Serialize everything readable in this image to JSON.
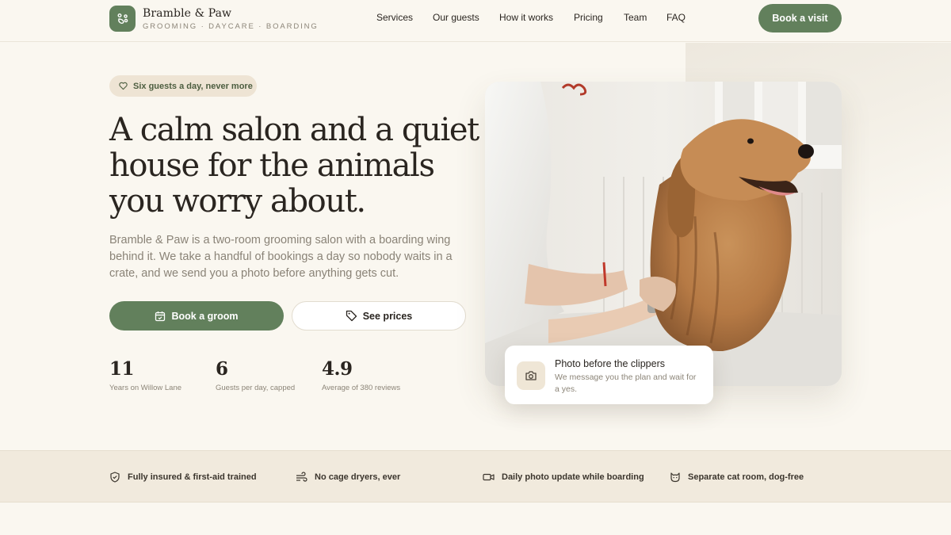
{
  "brand": {
    "name": "Bramble & Paw",
    "tagline": "GROOMING · DAYCARE · BOARDING",
    "accent": "#62805c"
  },
  "nav": {
    "items": [
      "Services",
      "Our guests",
      "How it works",
      "Pricing",
      "Team",
      "FAQ"
    ],
    "cta": "Book a visit"
  },
  "hero": {
    "pill": "Six guests a day, never more",
    "heading_line1": "A calm salon and a quiet",
    "heading_line2": "house for the animals",
    "heading_line3": "you worry about.",
    "lead": "Bramble & Paw is a two-room grooming salon with a boarding wing behind it. We take a handful of bookings a day so nobody waits in a crate, and we send you a photo before anything gets cut.",
    "primary_button": "Book a groom",
    "secondary_button": "See prices"
  },
  "stats": [
    {
      "value": "11",
      "label": "Years on Willow Lane"
    },
    {
      "value": "6",
      "label": "Guests per day, capped"
    },
    {
      "value": "4.9",
      "label": "Average of 380 reviews"
    }
  ],
  "photo_card": {
    "title": "Photo before the clippers",
    "text": "We message you the plan and wait for a yes.",
    "icon": "camera-icon"
  },
  "features": [
    {
      "icon": "shield-check-icon",
      "label": "Fully insured & first-aid trained"
    },
    {
      "icon": "wind-icon",
      "label": "No cage dryers, ever"
    },
    {
      "icon": "video-icon",
      "label": "Daily photo update while boarding"
    },
    {
      "icon": "cat-icon",
      "label": "Separate cat room, dog-free"
    }
  ]
}
